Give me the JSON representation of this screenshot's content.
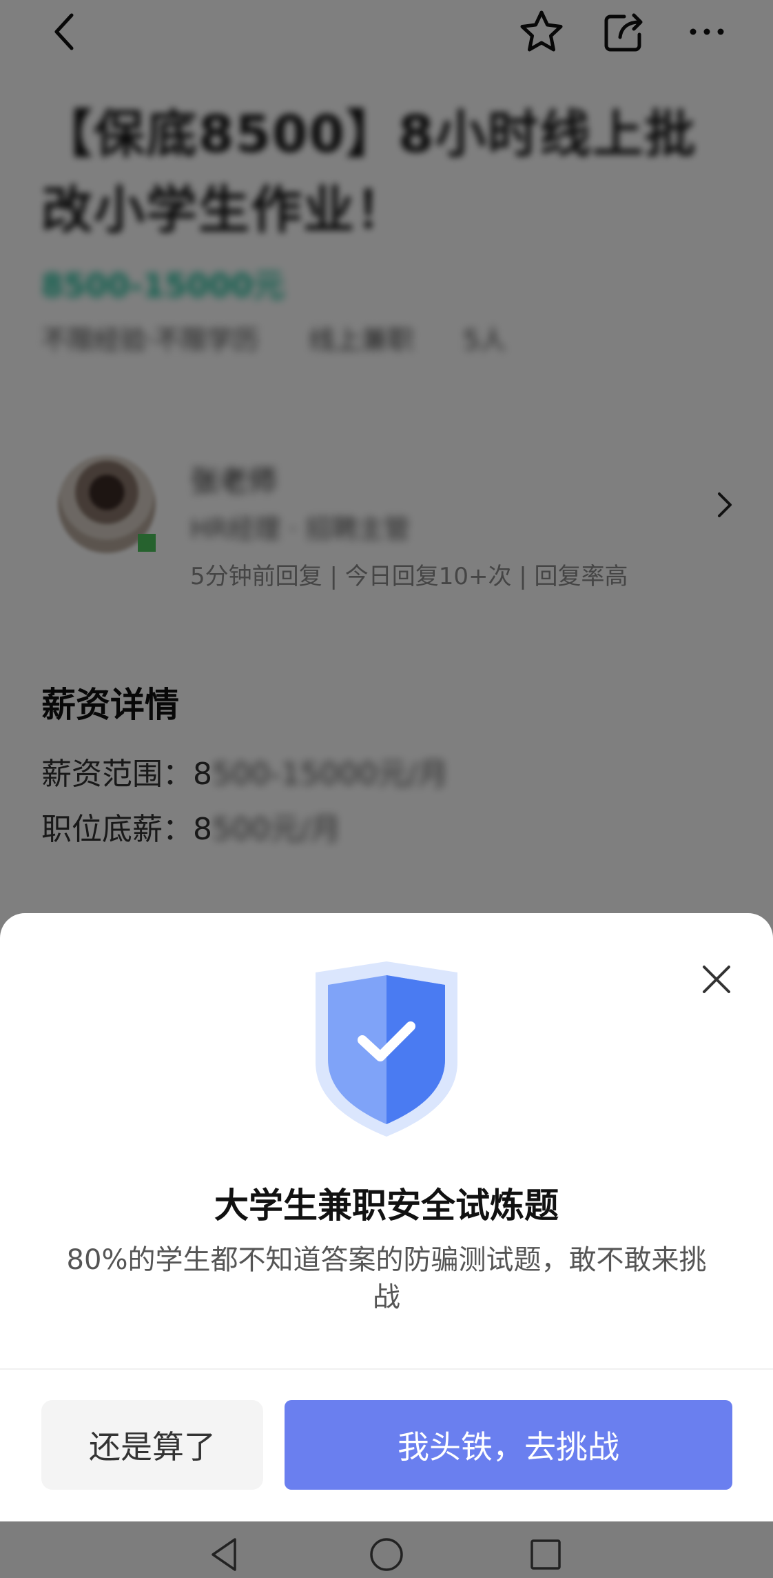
{
  "topbar": {
    "back_icon": "chevron-left-icon",
    "favorite_icon": "star-icon",
    "share_icon": "share-icon",
    "more_icon": "more-dots-icon"
  },
  "job": {
    "title": "【保底8500】8小时线上批改小学生作业！",
    "salary": "8500-15000元",
    "meta": [
      "不限经验·不限学历",
      "线上兼职",
      "5人"
    ]
  },
  "recruiter": {
    "name": "张老师",
    "role": "HR经理 · 招聘主管",
    "status": "5分钟前回复 | 今日回复10+次 | 回复率高"
  },
  "salary_details": {
    "title": "薪资详情",
    "range_label": "薪资范围：",
    "range_value_visible": "8",
    "range_value_blurred": "500-15000元/月",
    "base_label": "职位底薪：",
    "base_value_visible": "8",
    "base_value_blurred": "500元/月"
  },
  "modal": {
    "title": "大学生兼职安全试炼题",
    "description": "80%的学生都不知道答案的防骗测试题，敢不敢来挑战",
    "cancel_label": "还是算了",
    "confirm_label": "我头铁，去挑战",
    "colors": {
      "primary": "#6a7fef",
      "shield": "#4a7bf2"
    }
  },
  "system_nav": {
    "back": "triangle-back-icon",
    "home": "circle-home-icon",
    "recents": "square-recents-icon"
  }
}
